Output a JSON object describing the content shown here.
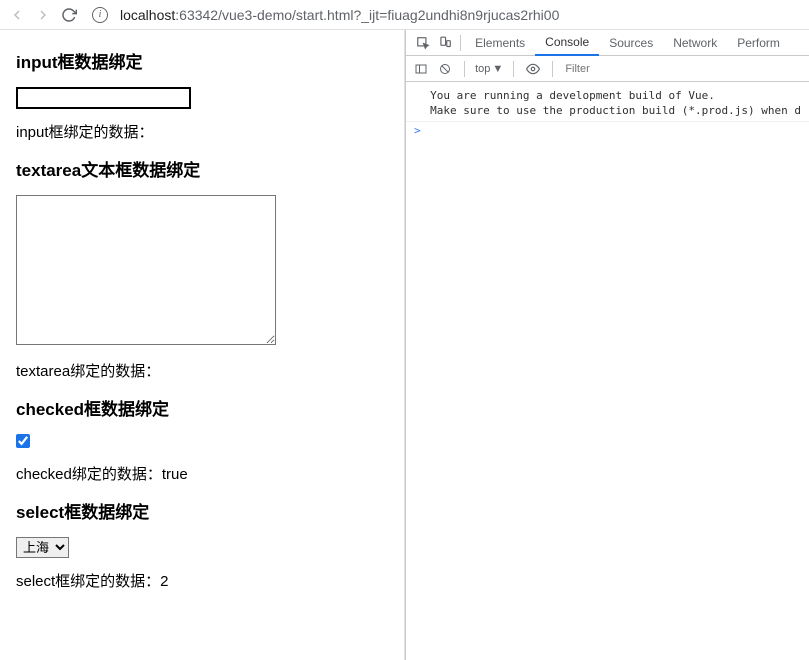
{
  "browser": {
    "url_host": "localhost",
    "url_rest": ":63342/vue3-demo/start.html?_ijt=fiuag2undhi8n9rjucas2rhi00"
  },
  "page": {
    "h_input": "input框数据绑定",
    "input_value": "",
    "p_input": "input框绑定的数据：",
    "h_textarea": "textarea文本框数据绑定",
    "textarea_value": "",
    "p_textarea": "textarea绑定的数据：",
    "h_checked": "checked框数据绑定",
    "p_checked": "checked绑定的数据：true",
    "h_select": "select框数据绑定",
    "select_option": "上海",
    "p_select": "select框绑定的数据：2"
  },
  "devtools": {
    "tabs": {
      "elements": "Elements",
      "console": "Console",
      "sources": "Sources",
      "network": "Network",
      "perform": "Perform"
    },
    "top_label": "top",
    "filter_placeholder": "Filter",
    "log1": "You are running a development build of Vue.",
    "log2": "Make sure to use the production build (*.prod.js) when d",
    "prompt": ">"
  }
}
